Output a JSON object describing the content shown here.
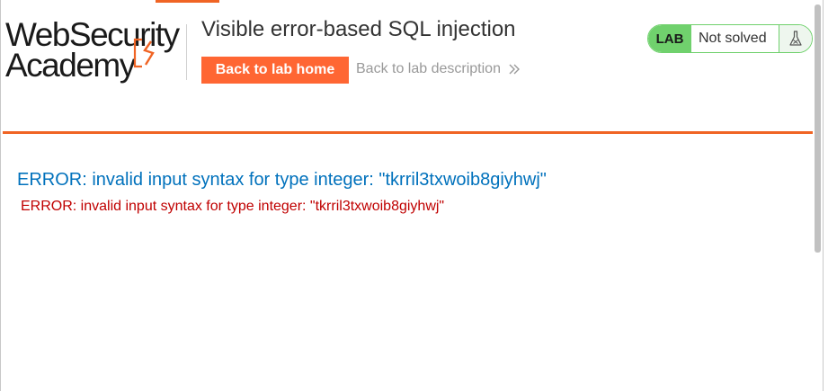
{
  "logo": {
    "line1": "WebSecurity",
    "line2": "Academy"
  },
  "header": {
    "title": "Visible error-based SQL injection",
    "back_home_label": "Back to lab home",
    "back_desc_label": "Back to lab description"
  },
  "status": {
    "badge": "LAB",
    "text": "Not solved"
  },
  "content": {
    "error_heading": "ERROR: invalid input syntax for type integer: \"tkrril3txwoib8giyhwj\"",
    "error_detail": "ERROR: invalid input syntax for type integer: \"tkrril3txwoib8giyhwj\""
  },
  "colors": {
    "accent": "#ff6633",
    "rule": "#f06424",
    "status_green": "#70d16d",
    "error_heading": "#0071bc",
    "error_detail": "#c00000"
  },
  "icons": {
    "logo_mark": "lightning-bolt-icon",
    "chevrons": "double-chevron-right-icon",
    "flask": "flask-icon"
  }
}
